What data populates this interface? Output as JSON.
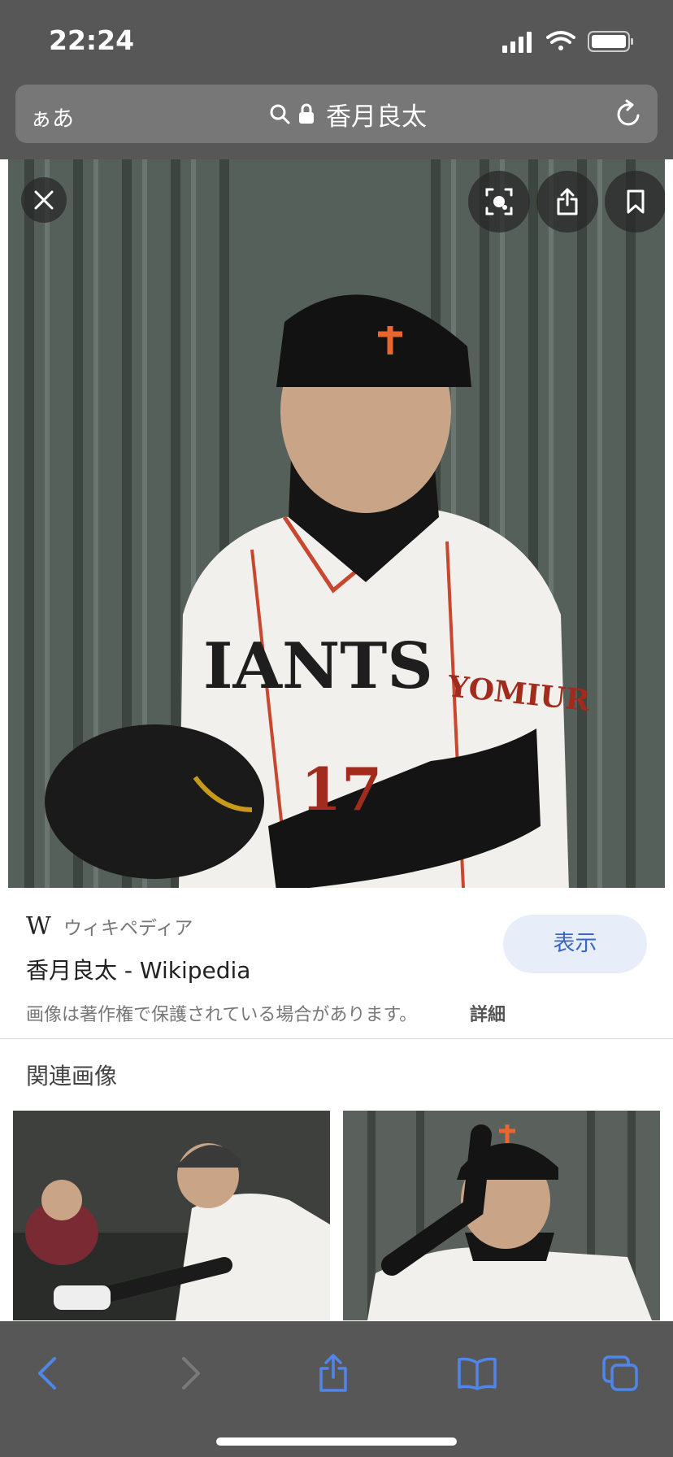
{
  "status": {
    "time": "22:24"
  },
  "urlbar": {
    "aa_label": "ぁあ",
    "query": "香月良太"
  },
  "card": {
    "source_logo": "W",
    "source_name": "ウィキペディア",
    "title": "香月良太 - Wikipedia",
    "show_label": "表示",
    "copyright_notice": "画像は著作権で保護されている場合があります。",
    "details_label": "詳細"
  },
  "related": {
    "title": "関連画像"
  },
  "icons": {
    "close": "close-icon",
    "lens": "visual-lookup-icon",
    "share": "share-icon",
    "bookmark": "bookmark-icon",
    "back": "chevron-left-icon",
    "forward": "chevron-right-icon",
    "book": "book-icon",
    "tabs": "tabs-icon"
  },
  "colors": {
    "chrome": "#575757",
    "accent": "#3a66c4",
    "button_bg": "#e8eef9"
  }
}
